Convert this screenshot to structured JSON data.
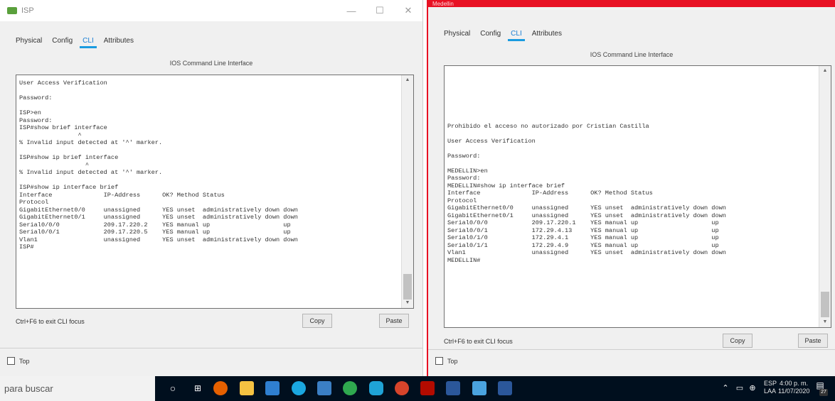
{
  "left_window": {
    "title": "ISP",
    "controls": {
      "minimize": "—",
      "maximize": "☐",
      "close": "✕"
    },
    "tabs": [
      "Physical",
      "Config",
      "CLI",
      "Attributes"
    ],
    "cli_label": "IOS Command Line Interface",
    "terminal_lines": [
      "User Access Verification",
      "",
      "Password:",
      "",
      "ISP>en",
      "Password:",
      "ISP#show brief interface",
      "                ^",
      "% Invalid input detected at '^' marker.",
      "",
      "ISP#show ip brief interface",
      "                  ^",
      "% Invalid input detected at '^' marker.",
      "",
      "ISP#show ip interface brief",
      "Interface              IP-Address      OK? Method Status",
      "Protocol",
      "GigabitEthernet0/0     unassigned      YES unset  administratively down down",
      "GigabitEthernet0/1     unassigned      YES unset  administratively down down",
      "Serial0/0/0            209.17.220.2    YES manual up                    up",
      "Serial0/0/1            209.17.220.5    YES manual up                    up",
      "Vlan1                  unassigned      YES unset  administratively down down",
      "ISP#"
    ],
    "exit_hint": "Ctrl+F6 to exit CLI focus",
    "copy_label": "Copy",
    "paste_label": "Paste",
    "top_label": "Top"
  },
  "right_window": {
    "title": "Medellin",
    "tabs": [
      "Physical",
      "Config",
      "CLI",
      "Attributes"
    ],
    "cli_label": "IOS Command Line Interface",
    "terminal_lines": [
      "",
      "",
      "",
      "",
      "",
      "",
      "",
      "Prohibido el acceso no autorizado por Cristian Castilla",
      "",
      "User Access Verification",
      "",
      "Password:",
      "",
      "MEDELLIN>en",
      "Password:",
      "MEDELLIN#show ip interface brief",
      "Interface              IP-Address      OK? Method Status",
      "Protocol",
      "GigabitEthernet0/0     unassigned      YES unset  administratively down down",
      "GigabitEthernet0/1     unassigned      YES unset  administratively down down",
      "Serial0/0/0            209.17.220.1    YES manual up                    up",
      "Serial0/0/1            172.29.4.13     YES manual up                    up",
      "Serial0/1/0            172.29.4.1      YES manual up                    up",
      "Serial0/1/1            172.29.4.9      YES manual up                    up",
      "Vlan1                  unassigned      YES unset  administratively down down",
      "MEDELLIN#"
    ],
    "exit_hint": "Ctrl+F6 to exit CLI focus",
    "copy_label": "Copy",
    "paste_label": "Paste",
    "top_label": "Top"
  },
  "taskbar": {
    "search_text": "para buscar",
    "lang_top": "ESP",
    "lang_bottom": "LAA",
    "time": "4:00 p. m.",
    "date": "11/07/2020",
    "notification_count": "27"
  }
}
